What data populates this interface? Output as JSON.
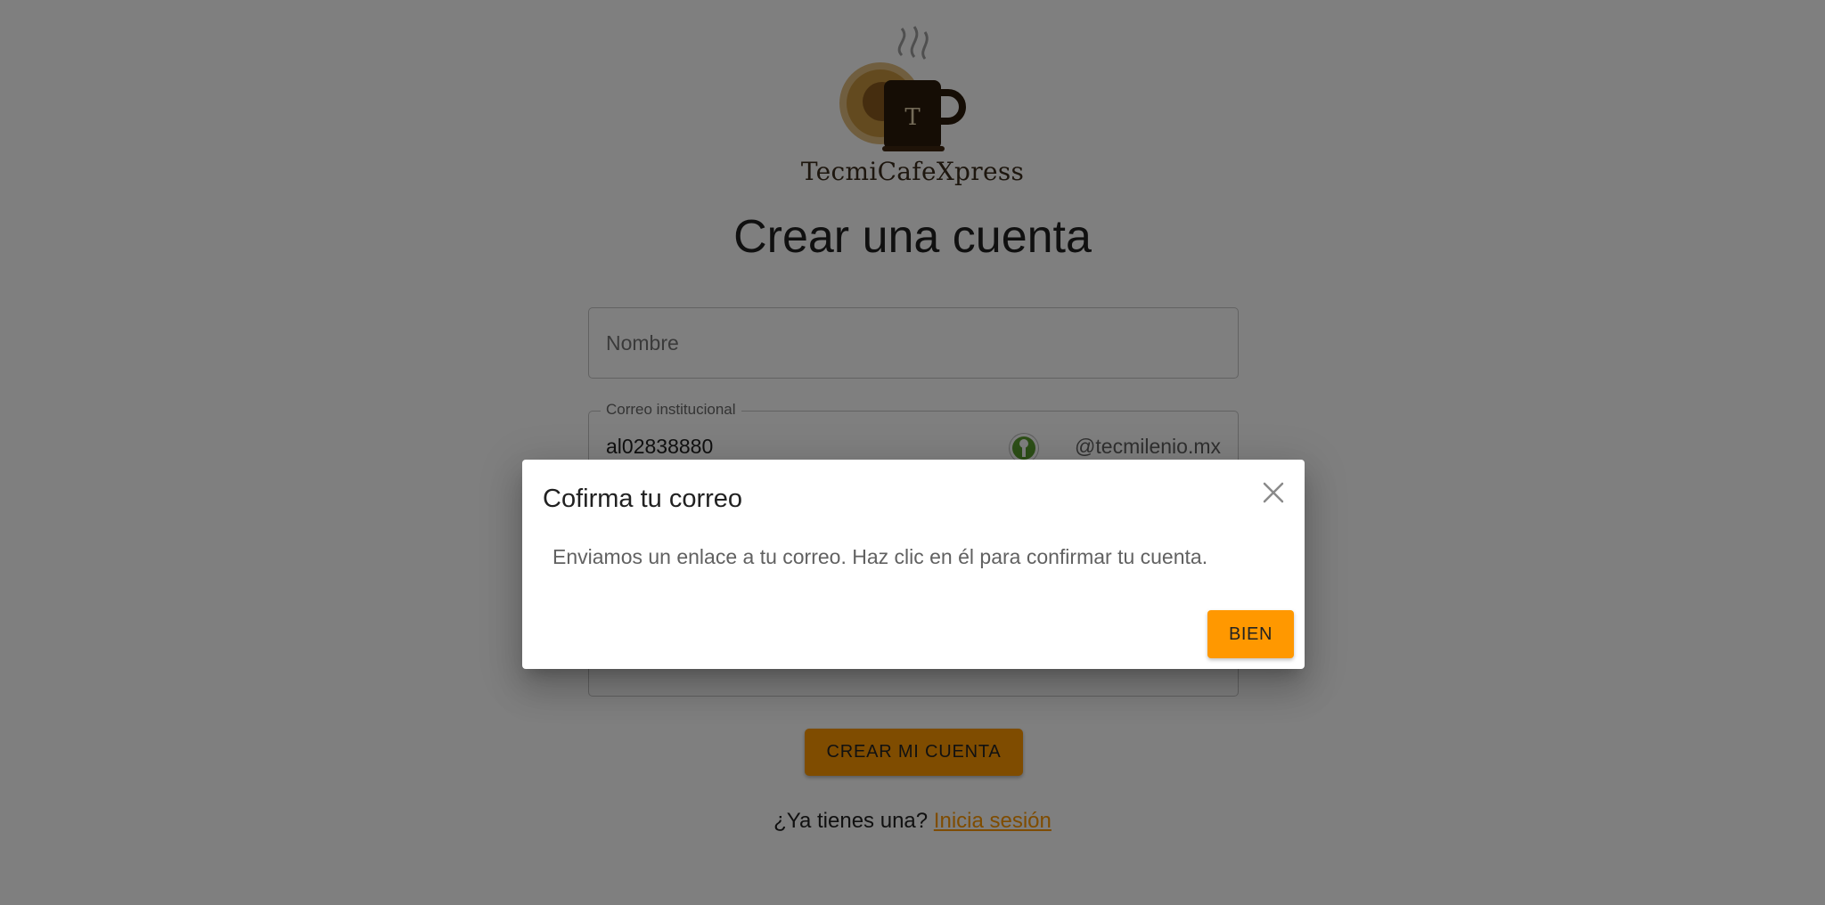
{
  "brand": {
    "name": "TecmiCafeXpress",
    "logo_icon": "coffee-mug-icon"
  },
  "page": {
    "title": "Crear una cuenta"
  },
  "form": {
    "name_placeholder": "Nombre",
    "email_label": "Correo institucional",
    "email_value": "al02838880",
    "email_suffix": "@tecmilenio.mx",
    "submit_label": "CREAR MI CUENTA"
  },
  "login_prompt": {
    "text": "¿Ya tienes una?",
    "link": "Inicia sesión"
  },
  "dialog": {
    "title": "Cofirma tu correo",
    "message": "Enviamos un enlace a tu correo. Haz clic en él para confirmar tu cuenta.",
    "ok_label": "BIEN"
  },
  "colors": {
    "accent": "#ff9800",
    "overlay": "rgba(0,0,0,0.5)"
  }
}
